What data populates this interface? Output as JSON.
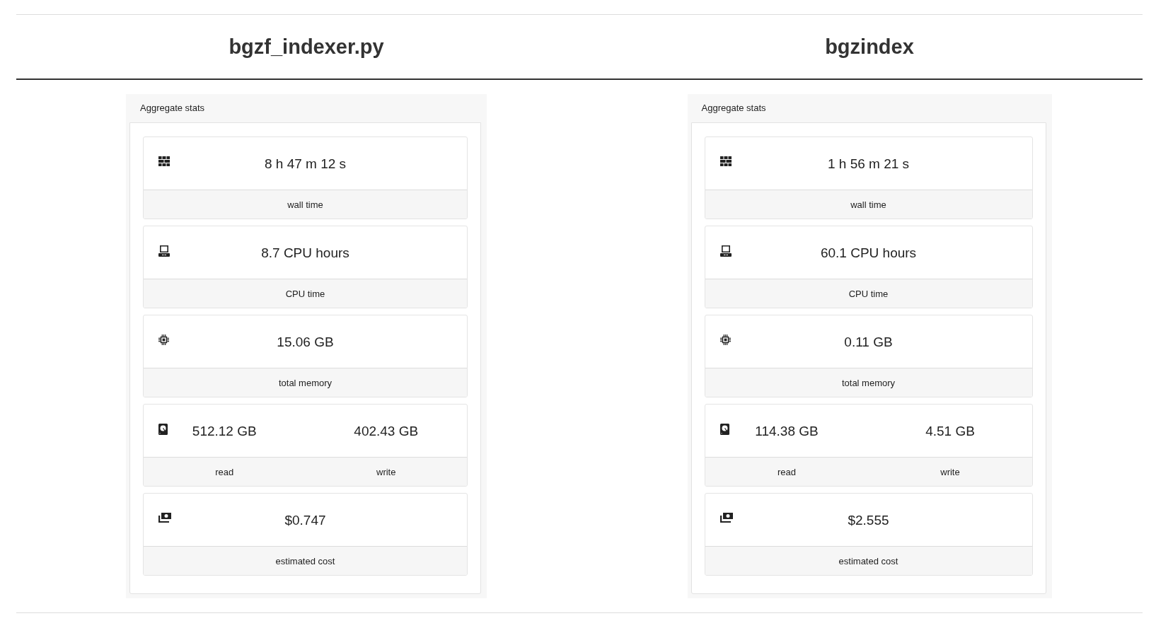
{
  "columns": [
    {
      "title": "bgzf_indexer.py",
      "panel": {
        "title": "Aggregate stats",
        "stats": [
          {
            "kind": "single",
            "value": "8 h 47 m 12 s",
            "label": "wall time"
          },
          {
            "kind": "single",
            "value": "8.7 CPU hours",
            "label": "CPU time"
          },
          {
            "kind": "single",
            "value": "15.06 GB",
            "label": "total memory"
          },
          {
            "kind": "pair",
            "parts": [
              {
                "value": "512.12 GB",
                "label": "read"
              },
              {
                "value": "402.43 GB",
                "label": "write"
              }
            ]
          },
          {
            "kind": "single",
            "value": "$0.747",
            "label": "estimated cost"
          }
        ]
      }
    },
    {
      "title": "bgzindex",
      "panel": {
        "title": "Aggregate stats",
        "stats": [
          {
            "kind": "single",
            "value": "1 h 56 m 21 s",
            "label": "wall time"
          },
          {
            "kind": "single",
            "value": "60.1 CPU hours",
            "label": "CPU time"
          },
          {
            "kind": "single",
            "value": "0.11 GB",
            "label": "total memory"
          },
          {
            "kind": "pair",
            "parts": [
              {
                "value": "114.38 GB",
                "label": "read"
              },
              {
                "value": "4.51 GB",
                "label": "write"
              }
            ]
          },
          {
            "kind": "single",
            "value": "$2.555",
            "label": "estimated cost"
          }
        ]
      }
    }
  ]
}
